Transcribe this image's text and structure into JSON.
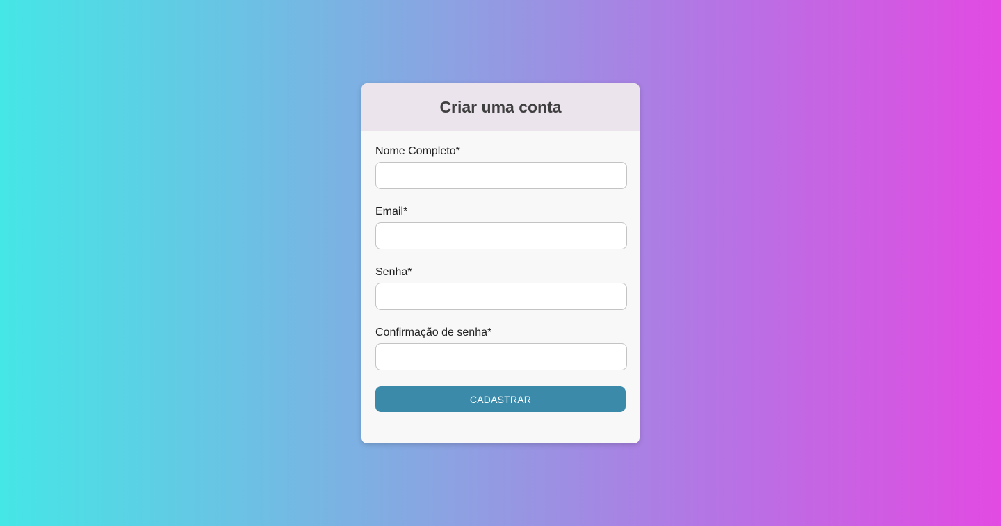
{
  "form": {
    "title": "Criar uma conta",
    "fields": [
      {
        "label": "Nome Completo*",
        "value": "",
        "placeholder": ""
      },
      {
        "label": "Email*",
        "value": "",
        "placeholder": ""
      },
      {
        "label": "Senha*",
        "value": "",
        "placeholder": ""
      },
      {
        "label": "Confirmação de senha*",
        "value": "",
        "placeholder": ""
      }
    ],
    "submit_label": "CADASTRAR"
  },
  "colors": {
    "gradient_start": "#45e6e6",
    "gradient_end": "#e24ae2",
    "header_bg": "#ece4ec",
    "card_bg": "#f8f8f8",
    "button_bg": "#3b8aa9",
    "button_text": "#ffffff"
  }
}
